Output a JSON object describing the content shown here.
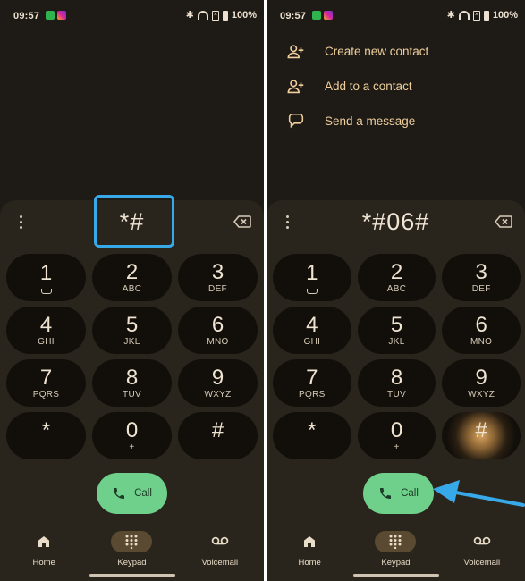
{
  "status": {
    "time": "09:57",
    "battery": "100%"
  },
  "left": {
    "digits": "*#",
    "keys": [
      {
        "digit": "1",
        "letters": ""
      },
      {
        "digit": "2",
        "letters": "ABC"
      },
      {
        "digit": "3",
        "letters": "DEF"
      },
      {
        "digit": "4",
        "letters": "GHI"
      },
      {
        "digit": "5",
        "letters": "JKL"
      },
      {
        "digit": "6",
        "letters": "MNO"
      },
      {
        "digit": "7",
        "letters": "PQRS"
      },
      {
        "digit": "8",
        "letters": "TUV"
      },
      {
        "digit": "9",
        "letters": "WXYZ"
      },
      {
        "digit": "*",
        "letters": ""
      },
      {
        "digit": "0",
        "letters": "+"
      },
      {
        "digit": "#",
        "letters": ""
      }
    ],
    "call_label": "Call"
  },
  "right": {
    "digits": "*#06#",
    "suggestions": [
      {
        "label": "Create new contact",
        "icon": "add-person-icon"
      },
      {
        "label": "Add to a contact",
        "icon": "add-person-icon"
      },
      {
        "label": "Send a message",
        "icon": "message-icon"
      }
    ],
    "call_label": "Call"
  },
  "nav": [
    {
      "label": "Home",
      "icon": "home-icon"
    },
    {
      "label": "Keypad",
      "icon": "dialpad-icon",
      "active": true
    },
    {
      "label": "Voicemail",
      "icon": "voicemail-icon"
    }
  ],
  "colors": {
    "background": "#1e1b16",
    "accent_text": "#f0cf9d",
    "call_button": "#6fd08c",
    "highlight": "#38a9e8"
  }
}
